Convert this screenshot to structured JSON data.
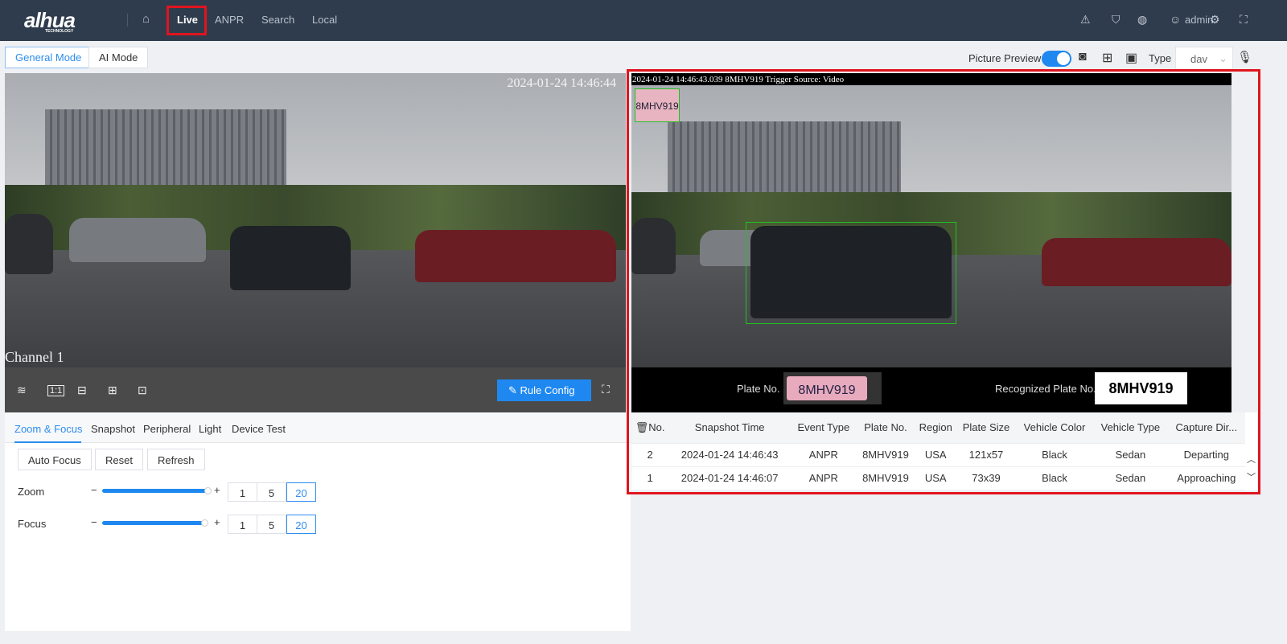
{
  "header": {
    "logo": "alhua",
    "logo_sub": "TECHNOLOGY",
    "nav": [
      "Live",
      "ANPR",
      "Search",
      "Local"
    ],
    "user": "admin"
  },
  "modes": [
    "General Mode",
    "AI Mode"
  ],
  "toolbar": {
    "picture_preview": "Picture Preview",
    "picture_preview_on": true,
    "type_label": "Type",
    "type_value": "dav"
  },
  "live": {
    "timestamp": "2024-01-24 14:46:44",
    "channel": "Channel 1",
    "rule_config": "Rule Config"
  },
  "tabs": [
    "Zoom & Focus",
    "Snapshot",
    "Peripheral",
    "Light",
    "Device Test"
  ],
  "zoom_focus": {
    "buttons": [
      "Auto Focus",
      "Reset",
      "Refresh"
    ],
    "zoom_label": "Zoom",
    "focus_label": "Focus",
    "zoom_level": 0.99,
    "focus_level": 0.96,
    "steps": [
      "1",
      "5",
      "20"
    ],
    "selected_step": "20",
    "minus": "−",
    "plus": "+"
  },
  "snapshot": {
    "overlay": "2024-01-24 14:46:43.039 8MHV919 Trigger Source: Video",
    "plate_label": "Plate No.",
    "plate_image_text": "8MHV919",
    "recognized_label": "Recognized Plate No.",
    "recognized_value": "8MHV919"
  },
  "table": {
    "headers": [
      "No.",
      "Snapshot Time",
      "Event Type",
      "Plate No.",
      "Region",
      "Plate Size",
      "Vehicle Color",
      "Vehicle Type",
      "Capture Dir..."
    ],
    "rows": [
      [
        "2",
        "2024-01-24 14:46:43",
        "ANPR",
        "8MHV919",
        "USA",
        "121x57",
        "Black",
        "Sedan",
        "Departing"
      ],
      [
        "1",
        "2024-01-24 14:46:07",
        "ANPR",
        "8MHV919",
        "USA",
        "73x39",
        "Black",
        "Sedan",
        "Approaching"
      ]
    ]
  },
  "colors": {
    "accent": "#1e88f0",
    "header": "#2f3c4d",
    "highlight": "#e0141e"
  }
}
